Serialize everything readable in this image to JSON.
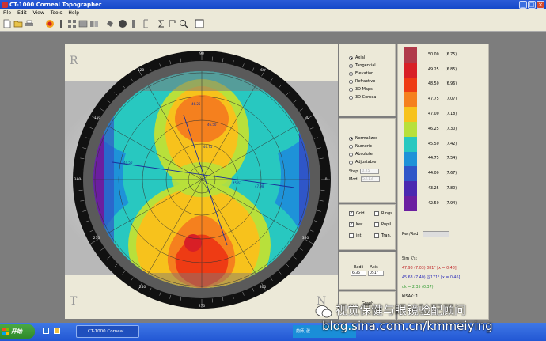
{
  "window": {
    "title": "CT-1000 Corneal Topographer"
  },
  "menu": [
    "File",
    "Edit",
    "View",
    "Tools",
    "Help"
  ],
  "map": {
    "corner_labels": {
      "tl": "R",
      "bl": "T",
      "br": "N"
    },
    "degree_labels": [
      "90",
      "120",
      "150",
      "180",
      "210",
      "240",
      "270",
      "300",
      "330",
      "0",
      "30",
      "60"
    ],
    "meridian_labels": [
      "46.25",
      "46.50",
      "46.75",
      "44.50",
      "45.63",
      "47.98"
    ]
  },
  "modes": {
    "options": [
      "Axial",
      "Tangential",
      "Elevation",
      "Refractive",
      "3D Maps",
      "3D Cornea"
    ],
    "selected": "Axial"
  },
  "scale": {
    "options": [
      "Normalized",
      "Numeric",
      "Absolute",
      "Adjustable"
    ],
    "selected": "Normalized",
    "step_label": "Step",
    "step_value": "0.25",
    "mod_label": "Mod.",
    "mod_value": "53.13"
  },
  "overlays": {
    "items": [
      {
        "label": "Grid",
        "checked": true
      },
      {
        "label": "Rings",
        "checked": false
      },
      {
        "label": "Ker",
        "checked": true
      },
      {
        "label": "Pupil",
        "checked": false
      },
      {
        "label": "int",
        "checked": false
      },
      {
        "label": "Tran.",
        "checked": false
      }
    ]
  },
  "radius": {
    "radii_label": "Radii",
    "axis_label": "Axis",
    "radii_value": "6.36",
    "axis_value": "051°"
  },
  "legend": {
    "entries": [
      {
        "d": "50.00",
        "mm": "(6.75)",
        "color": "#b03a4a"
      },
      {
        "d": "49.25",
        "mm": "(6.85)",
        "color": "#d81f26"
      },
      {
        "d": "48.50",
        "mm": "(6.96)",
        "color": "#ee3b14"
      },
      {
        "d": "47.75",
        "mm": "(7.07)",
        "color": "#f5801e"
      },
      {
        "d": "47.00",
        "mm": "(7.18)",
        "color": "#f7c21c"
      },
      {
        "d": "46.25",
        "mm": "(7.30)",
        "color": "#b8e03b"
      },
      {
        "d": "45.50",
        "mm": "(7.42)",
        "color": "#28c8c0"
      },
      {
        "d": "44.75",
        "mm": "(7.54)",
        "color": "#1e92d8"
      },
      {
        "d": "44.00",
        "mm": "(7.67)",
        "color": "#2f56c8"
      },
      {
        "d": "43.25",
        "mm": "(7.80)",
        "color": "#4a28b0"
      },
      {
        "d": "42.50",
        "mm": "(7.94)",
        "color": "#6b1ea0"
      }
    ],
    "pwr_label": "Pwr/Rad"
  },
  "keratometry": {
    "sim_label": "Sim K's:",
    "line1": "47.98 (7.03) 081°  [x = 0.48]",
    "line2": "45.63 (7.40) @171°  [x = 0.46]",
    "line3": "dk = 2.35 (0.37)",
    "line4": "KISAK: 1",
    "color1": "#c0282a",
    "color2": "#2a2ab8",
    "color3": "#2e9a2e"
  },
  "bottom_panel": {
    "label": "Graph"
  },
  "taskbar": {
    "start": "开始",
    "task": "CT-1000 Corneal ...",
    "tray_text": "药师, 张"
  },
  "watermark": {
    "line1": "视觉保健与眼镜验配顾问",
    "line2": "blog.sina.com.cn/kmmeiying"
  }
}
